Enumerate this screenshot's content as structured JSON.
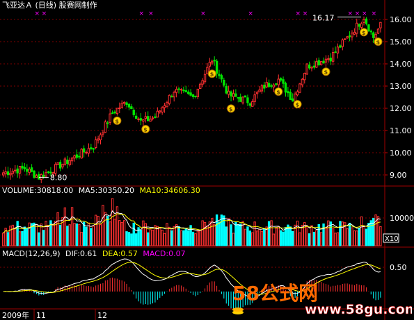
{
  "header": {
    "title": "飞亚达Ａ (日线) 股赛网制作"
  },
  "colors": {
    "up": "#ff3030",
    "down": "#00e600",
    "ma5": "#ffffff",
    "ma10": "#ffff00",
    "vol_up": "#ff3030",
    "vol_down": "#00ffff",
    "dif": "#ffffff",
    "dea": "#ffff00",
    "macd_label": "#ff00ff",
    "grid": "#800000",
    "axis_text": "#ffffff",
    "marker": "#ff00ff"
  },
  "chart_data": [
    {
      "type": "candlestick",
      "panel": "price",
      "ylim": [
        8.5,
        16.5
      ],
      "yticks": [
        "16.00",
        "15.00",
        "14.00",
        "13.00",
        "12.00",
        "11.00",
        "10.00",
        "9.00"
      ],
      "annotations": [
        {
          "text": "16.17",
          "value": 16.17
        },
        {
          "text": "8.80",
          "value": 8.8
        }
      ],
      "top_markers": 12,
      "coin_signals": 9,
      "approximate": true
    },
    {
      "type": "bar",
      "panel": "volume",
      "label": "VOLUME:30818.00",
      "ma5_label": "MA5:30350.20",
      "ma10_label": "MA10:34606.30",
      "ytick": "10000",
      "unit": "X10",
      "approximate": true
    },
    {
      "type": "line",
      "panel": "macd",
      "label": "MACD(12,26,9)",
      "dif_label": "DIF:0.61",
      "dea_label": "DEA:0.57",
      "macd_label": "MACD:0.07",
      "ytick": "0.50",
      "approximate": true
    }
  ],
  "xaxis": {
    "labels": [
      "2009年",
      "11",
      "12"
    ]
  },
  "watermark": {
    "brand": "58公式网",
    "url": "www.58gu.com"
  }
}
